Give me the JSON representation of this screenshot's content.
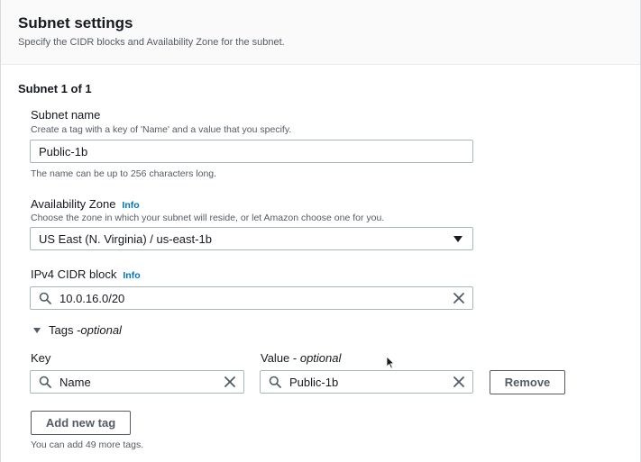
{
  "panel": {
    "title": "Subnet settings",
    "description": "Specify the CIDR blocks and Availability Zone for the subnet."
  },
  "subnet": {
    "heading": "Subnet 1 of 1",
    "name_label": "Subnet name",
    "name_description": "Create a tag with a key of 'Name' and a value that you specify.",
    "name_value": "Public-1b",
    "name_hint": "The name can be up to 256 characters long.",
    "az_label": "Availability Zone",
    "az_info": "Info",
    "az_description": "Choose the zone in which your subnet will reside, or let Amazon choose one for you.",
    "az_value": "US East (N. Virginia) / us-east-1b",
    "cidr_label": "IPv4 CIDR block",
    "cidr_info": "Info",
    "cidr_value": "10.0.16.0/20"
  },
  "tags": {
    "toggle_label": "Tags - ",
    "toggle_optional": "optional",
    "key_header": "Key",
    "value_header": "Value - ",
    "value_optional": "optional",
    "rows": [
      {
        "key": "Name",
        "value": "Public-1b",
        "remove_label": "Remove"
      }
    ],
    "add_label": "Add new tag",
    "limit_hint": "You can add 49 more tags."
  },
  "icons": {
    "search": "search-icon",
    "clear": "close-icon",
    "caret": "caret-down-icon",
    "expand": "caret-expanded-icon",
    "cursor": "mouse-pointer-icon"
  },
  "colors": {
    "link": "#0073bb",
    "border": "#aab7b8",
    "text": "#16191f",
    "muted": "#545b64"
  }
}
